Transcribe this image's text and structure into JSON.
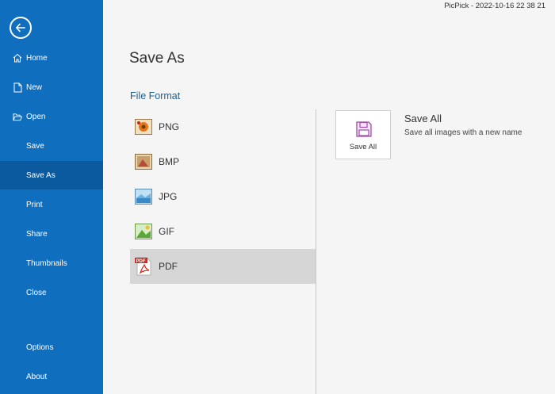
{
  "window": {
    "title": "PicPick - 2022-10-16 22 38 21"
  },
  "sidebar": {
    "back_icon": "arrow-left-circle-icon",
    "items": [
      {
        "label": "Home",
        "icon": "home-icon"
      },
      {
        "label": "New",
        "icon": "new-file-icon"
      },
      {
        "label": "Open",
        "icon": "folder-open-icon"
      },
      {
        "label": "Save"
      },
      {
        "label": "Save As",
        "active": true
      },
      {
        "label": "Print"
      },
      {
        "label": "Share"
      },
      {
        "label": "Thumbnails"
      },
      {
        "label": "Close"
      },
      {
        "label": "Options"
      },
      {
        "label": "About"
      }
    ]
  },
  "main": {
    "title": "Save As",
    "section_title": "File Format",
    "formats": [
      {
        "label": "PNG",
        "icon": "png-image-icon"
      },
      {
        "label": "BMP",
        "icon": "bmp-image-icon"
      },
      {
        "label": "JPG",
        "icon": "jpg-image-icon"
      },
      {
        "label": "GIF",
        "icon": "gif-image-icon"
      },
      {
        "label": "PDF",
        "icon": "pdf-file-icon",
        "selected": true
      }
    ],
    "save_all": {
      "tile_label": "Save All",
      "heading": "Save All",
      "description": "Save all images with a new name",
      "icon": "floppy-disk-icon"
    }
  },
  "colors": {
    "sidebar_bg": "#106ebe",
    "sidebar_active": "#0b5a9f",
    "accent_text": "#1f5f8b",
    "selected_row": "#d6d6d6"
  }
}
